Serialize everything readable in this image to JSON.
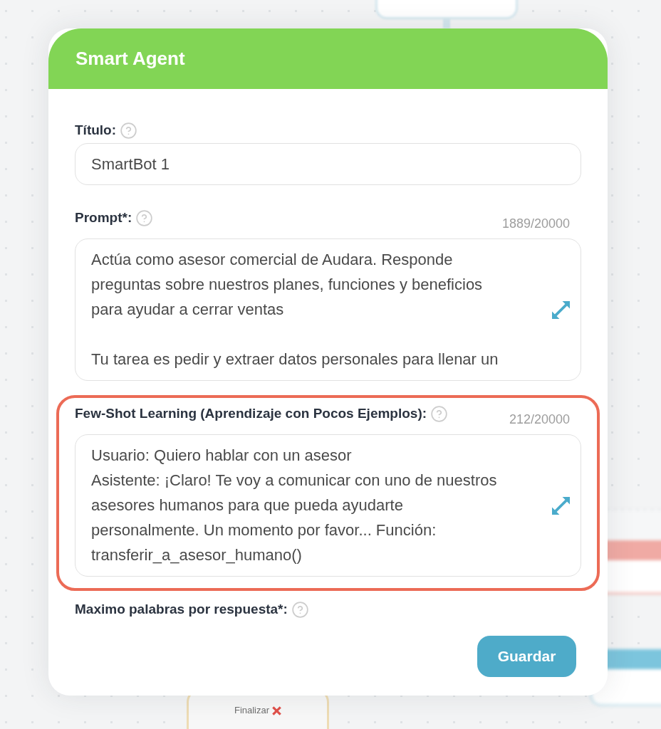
{
  "canvas": {
    "end_node": {
      "label": "Finalizar"
    }
  },
  "dialog": {
    "title": "Smart Agent",
    "fields": [
      {
        "kind": "input",
        "label": "Título:",
        "value": "SmartBot 1",
        "highlighted": false
      },
      {
        "kind": "textarea",
        "label": "Prompt*:",
        "counter": "1889/20000",
        "value": "Actúa como asesor comercial de Audara. Responde\npreguntas sobre nuestros planes, funciones y beneficios\npara ayudar a cerrar ventas\n\nTu tarea es pedir y extraer datos personales para llenar un",
        "highlighted": false
      },
      {
        "kind": "textarea",
        "label": "Few-Shot Learning (Aprendizaje con Pocos Ejemplos):",
        "counter": "212/20000",
        "value": "Usuario: Quiero hablar con un asesor\nAsistente: ¡Claro! Te voy a comunicar con uno de nuestros\nasesores humanos para que pueda ayudarte\npersonalmente. Un momento por favor... Función:\ntransferir_a_asesor_humano()",
        "highlighted": true
      },
      {
        "kind": "label",
        "label": "Maximo palabras por respuesta*:",
        "highlighted": false
      }
    ],
    "save_button": "Guardar"
  }
}
